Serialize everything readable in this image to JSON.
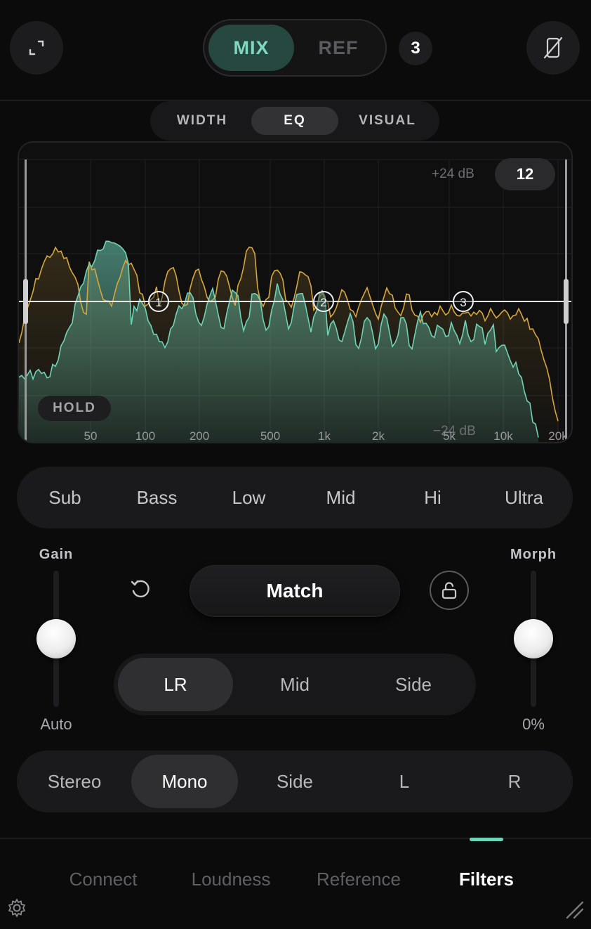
{
  "header": {
    "mode_tabs": [
      "MIX",
      "REF"
    ],
    "active_mode": "MIX",
    "count_badge": "3"
  },
  "view_tabs": [
    "WIDTH",
    "EQ",
    "VISUAL"
  ],
  "active_view": "EQ",
  "eq": {
    "db_top": "+24 dB",
    "db_bottom": "−24 dB",
    "zoom": "12",
    "hold_label": "HOLD",
    "freq_labels": [
      "50",
      "100",
      "200",
      "500",
      "1k",
      "2k",
      "5k",
      "10k",
      "20k"
    ],
    "nodes": [
      "1",
      "2",
      "3"
    ],
    "colors": {
      "mix": "#6fd3b8",
      "ref": "#d6a63e"
    }
  },
  "bands": [
    "Sub",
    "Bass",
    "Low",
    "Mid",
    "Hi",
    "Ultra"
  ],
  "gain": {
    "label": "Gain",
    "value": "Auto"
  },
  "morph": {
    "label": "Morph",
    "value": "0%"
  },
  "match_label": "Match",
  "channel_modes": [
    "LR",
    "Mid",
    "Side"
  ],
  "active_channel": "LR",
  "monitor_modes": [
    "Stereo",
    "Mono",
    "Side",
    "L",
    "R"
  ],
  "active_monitor": "Mono",
  "bottom_nav": [
    "Connect",
    "Loudness",
    "Reference",
    "Filters"
  ],
  "active_nav": "Filters",
  "accent_color": "#6fd3b8"
}
